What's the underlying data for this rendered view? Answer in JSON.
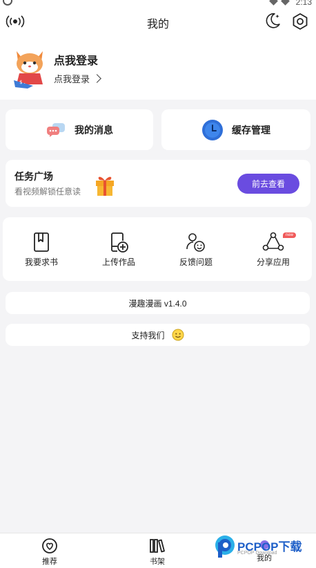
{
  "status_bar": {
    "time": "2:13"
  },
  "header": {
    "title": "我的"
  },
  "profile": {
    "name": "点我登录",
    "subtitle": "点我登录"
  },
  "quick": {
    "messages": {
      "label": "我的消息"
    },
    "cache": {
      "label": "缓存管理"
    }
  },
  "task": {
    "title": "任务广场",
    "subtitle": "看视频解锁任意读",
    "button": "前去查看"
  },
  "tools": [
    {
      "label": "我要求书",
      "icon": "book-request-icon"
    },
    {
      "label": "上传作品",
      "icon": "upload-work-icon"
    },
    {
      "label": "反馈问题",
      "icon": "feedback-icon"
    },
    {
      "label": "分享应用",
      "icon": "share-icon",
      "badge": "new"
    }
  ],
  "version": {
    "label": "漫趣漫画 v1.4.0"
  },
  "support": {
    "label": "支持我们"
  },
  "tabs": [
    {
      "label": "推荐",
      "icon": "recommend-icon"
    },
    {
      "label": "书架",
      "icon": "bookshelf-icon"
    },
    {
      "label": "我的",
      "icon": "mine-icon",
      "active": true
    }
  ],
  "watermark": {
    "brand": "PCPOP下载",
    "sub": "PCPOP Download"
  },
  "colors": {
    "accent": "#6a4ce0",
    "background": "#f4f4f6",
    "card": "#ffffff",
    "cache_icon": "#2f6fd8",
    "gift": "#f5a623"
  }
}
